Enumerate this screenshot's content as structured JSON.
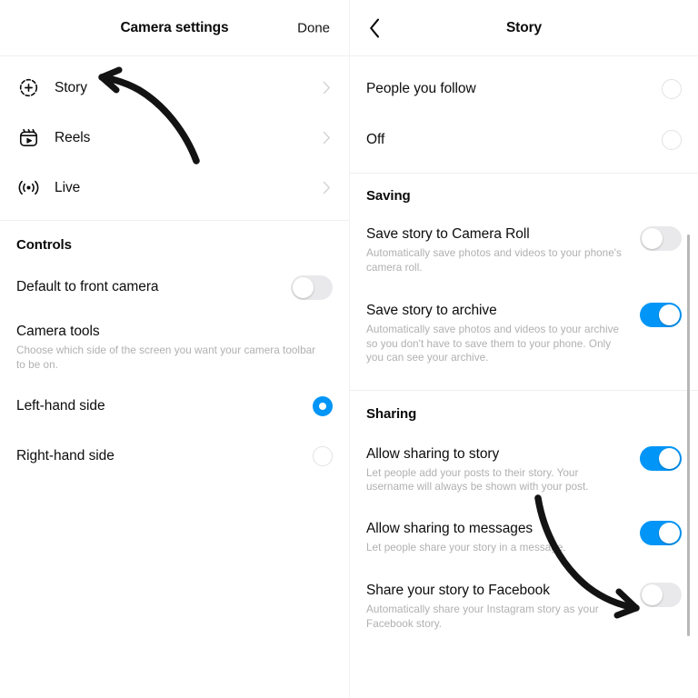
{
  "colors": {
    "accent_blue": "#0095F6",
    "toggle_off_track": "#E9E9EB",
    "text_primary": "#0D0D0D",
    "text_secondary": "#B0B0B0",
    "divider": "#EFEFEF",
    "annotation_arrow": "#111111"
  },
  "left_panel": {
    "header": {
      "title": "Camera settings",
      "done_label": "Done"
    },
    "nav_items": [
      {
        "label": "Story",
        "icon": "story-add-circle-icon",
        "chevron": "chevron-right-icon"
      },
      {
        "label": "Reels",
        "icon": "reels-clapboard-icon",
        "chevron": "chevron-right-icon"
      },
      {
        "label": "Live",
        "icon": "live-broadcast-icon",
        "chevron": "chevron-right-icon"
      }
    ],
    "controls_section": {
      "title": "Controls",
      "front_camera": {
        "title": "Default to front camera",
        "toggle_state": "off"
      },
      "camera_tools": {
        "title": "Camera tools",
        "subtitle": "Choose which side of the screen you want your camera toolbar to be on."
      },
      "side_options": [
        {
          "label": "Left-hand side",
          "selected": true
        },
        {
          "label": "Right-hand side",
          "selected": false
        }
      ]
    }
  },
  "right_panel": {
    "header": {
      "title": "Story",
      "back_icon": "chevron-left-icon"
    },
    "audience_options": [
      {
        "label": "People you follow",
        "selected": false
      },
      {
        "label": "Off",
        "selected": false
      }
    ],
    "saving_section": {
      "title": "Saving",
      "rows": [
        {
          "title": "Save story to Camera Roll",
          "subtitle": "Automatically save photos and videos to your phone's camera roll.",
          "toggle_state": "off"
        },
        {
          "title": "Save story to archive",
          "subtitle": "Automatically save photos and videos to your archive so you don't have to save them to your phone. Only you can see your archive.",
          "toggle_state": "on"
        }
      ]
    },
    "sharing_section": {
      "title": "Sharing",
      "rows": [
        {
          "title": "Allow sharing to story",
          "subtitle": "Let people add your posts to their story. Your username will always be shown with your post.",
          "toggle_state": "on"
        },
        {
          "title": "Allow sharing to messages",
          "subtitle": "Let people share your story in a message.",
          "toggle_state": "on"
        },
        {
          "title": "Share your story to Facebook",
          "subtitle": "Automatically share your Instagram story as your Facebook story.",
          "toggle_state": "off"
        }
      ]
    }
  },
  "annotations": [
    {
      "name": "arrow-pointing-to-story",
      "direction": "up-left"
    },
    {
      "name": "arrow-pointing-to-facebook-toggle",
      "direction": "down-right"
    }
  ]
}
